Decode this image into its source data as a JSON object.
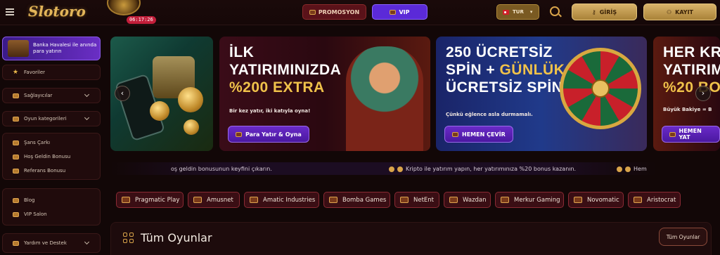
{
  "header": {
    "logo_text": "Slotoro",
    "timer": "06:17:26",
    "promo_label": "PROMOSYON",
    "vip_label": "VIP",
    "language": "TUR",
    "login_label": "GİRİŞ",
    "register_label": "KAYIT"
  },
  "sidebar": {
    "promo_card": "Banka Havalesi ile anında para yatırın",
    "group1": [
      {
        "label": "Favoriler",
        "icon": "star-icon"
      }
    ],
    "group2": [
      {
        "label": "Sağlayıcılar",
        "icon": "provider-icon"
      }
    ],
    "group3": [
      {
        "label": "Oyun kategorileri",
        "icon": "category-icon"
      }
    ],
    "group4": [
      {
        "label": "Şans Çarkı",
        "icon": "wheel-icon"
      },
      {
        "label": "Hoş Geldin Bonusu",
        "icon": "gift-icon"
      },
      {
        "label": "Referans Bonusu",
        "icon": "referral-icon"
      }
    ],
    "group5": [
      {
        "label": "Blog",
        "icon": "blog-icon"
      },
      {
        "label": "VIP Salon",
        "icon": "vip-icon"
      }
    ],
    "group6": [
      {
        "label": "Yardım ve Destek",
        "icon": "support-icon"
      }
    ]
  },
  "slides": [
    {
      "title_line1": "İLK",
      "title_line2": "YATIRIMINIZDA",
      "title_line3": "%200 EXTRA",
      "subtitle": "Bir kez yatır, iki katıyla oyna!",
      "cta": "Para Yatır & Oyna"
    },
    {
      "title_line1": "250 ÜCRETSİZ",
      "title_line2a": "SPİN + ",
      "title_line2b": "GÜNLÜK 10",
      "title_line3": "ÜCRETSİZ SPİN",
      "subtitle": "Çünkü eğlence asla durmamalı.",
      "cta": "HEMEN ÇEVİR"
    },
    {
      "title_line1": "HER KRİ",
      "title_line2": "YATIRIM",
      "title_line3": "%20 BO",
      "subtitle": "Büyük Bakiye = B",
      "cta": "HEMEN YAT"
    }
  ],
  "ticker": {
    "item1": "oş geldin bonusunun keyfini çıkarın.",
    "item2": "Kripto ile yatırım yapın, her yatırımınıza %20 bonus kazanın.",
    "item3": "Hem"
  },
  "providers": [
    "Pragmatic Play",
    "Amusnet",
    "Amatic Industries",
    "Bomba Games",
    "NetEnt",
    "Wazdan",
    "Merkur Gaming",
    "Novomatic",
    "Aristocrat"
  ],
  "games": {
    "title": "Tüm Oyunlar",
    "all_button": "Tüm Oyunlar"
  },
  "colors": {
    "background": "#120707",
    "gold": "#d9b36a",
    "vip_purple": "#5b2ad8",
    "provider_border": "#8a2a34"
  }
}
